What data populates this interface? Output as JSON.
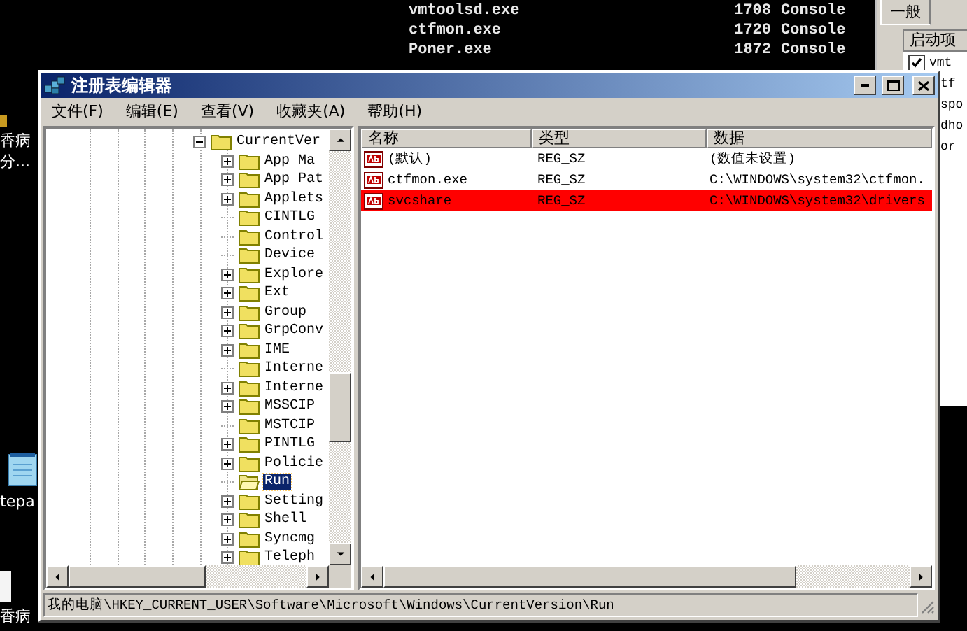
{
  "console": {
    "rows": [
      {
        "name": "vmtoolsd.exe",
        "pid": "1708",
        "session": "Console"
      },
      {
        "name": "ctfmon.exe",
        "pid": "1720",
        "session": "Console"
      },
      {
        "name": "Poner.exe",
        "pid": "1872",
        "session": "Console"
      }
    ]
  },
  "side_dialog": {
    "tab": "一般",
    "header": "启动项",
    "first_item": {
      "label": "vmt",
      "checked": true
    },
    "more_items": [
      "tf",
      "spo",
      "dho",
      "or"
    ]
  },
  "desktop_labels": [
    "香病",
    "分...",
    "tepa",
    "香病"
  ],
  "regedit": {
    "title": "注册表编辑器",
    "menu": [
      "文件(F)",
      "编辑(E)",
      "查看(V)",
      "收藏夹(A)",
      "帮助(H)"
    ],
    "tree": {
      "label": "CurrentVer",
      "expanded": true,
      "children": [
        {
          "label": "App Ma",
          "expandable": true,
          "selected": false
        },
        {
          "label": "App Pat",
          "expandable": true,
          "selected": false
        },
        {
          "label": "Applets",
          "expandable": true,
          "selected": false
        },
        {
          "label": "CINTLG",
          "expandable": false,
          "selected": false
        },
        {
          "label": "Control",
          "expandable": false,
          "selected": false
        },
        {
          "label": "Device",
          "expandable": false,
          "selected": false
        },
        {
          "label": "Explore",
          "expandable": true,
          "selected": false
        },
        {
          "label": "Ext",
          "expandable": true,
          "selected": false
        },
        {
          "label": "Group",
          "expandable": true,
          "selected": false
        },
        {
          "label": "GrpConv",
          "expandable": true,
          "selected": false
        },
        {
          "label": "IME",
          "expandable": true,
          "selected": false
        },
        {
          "label": "Interne",
          "expandable": false,
          "selected": false
        },
        {
          "label": "Interne",
          "expandable": true,
          "selected": false
        },
        {
          "label": "MSSCIP",
          "expandable": true,
          "selected": false
        },
        {
          "label": "MSTCIP",
          "expandable": false,
          "selected": false
        },
        {
          "label": "PINTLG",
          "expandable": true,
          "selected": false
        },
        {
          "label": "Policie",
          "expandable": true,
          "selected": false
        },
        {
          "label": "Run",
          "expandable": false,
          "selected": true
        },
        {
          "label": "Setting",
          "expandable": true,
          "selected": false
        },
        {
          "label": "Shell",
          "expandable": true,
          "selected": false
        },
        {
          "label": "Syncmg",
          "expandable": true,
          "selected": false
        },
        {
          "label": "Teleph",
          "expandable": true,
          "selected": false
        }
      ]
    },
    "columns": [
      "名称",
      "类型",
      "数据"
    ],
    "values": [
      {
        "name": "(默认)",
        "type": "REG_SZ",
        "data": "(数值未设置)",
        "marked": false
      },
      {
        "name": "ctfmon.exe",
        "type": "REG_SZ",
        "data": "C:\\WINDOWS\\system32\\ctfmon.",
        "marked": false
      },
      {
        "name": "svcshare",
        "type": "REG_SZ",
        "data": "C:\\WINDOWS\\system32\\drivers",
        "marked": true
      }
    ],
    "status_bar": "我的电脑\\HKEY_CURRENT_USER\\Software\\Microsoft\\Windows\\CurrentVersion\\Run"
  }
}
